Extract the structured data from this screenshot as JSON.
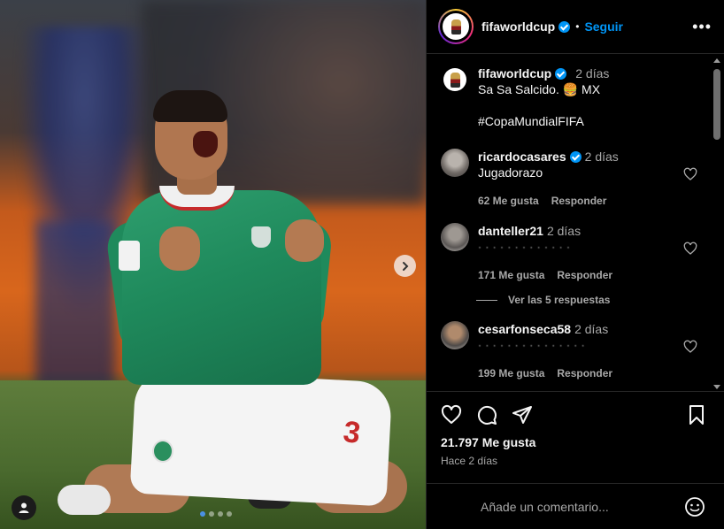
{
  "post": {
    "jersey_number": "3",
    "carousel": {
      "count": 4,
      "active": 0
    }
  },
  "header": {
    "username": "fifaworldcup",
    "separator": "•",
    "follow_label": "Seguir",
    "more_label": "•••"
  },
  "caption": {
    "username": "fifaworldcup",
    "time": "2 días",
    "text": "Sa Sa Salcido. 🍔 MX",
    "hashtag": "#CopaMundialFIFA"
  },
  "comments": [
    {
      "username": "ricardocasares",
      "verified": true,
      "time": "2 días",
      "text": "Jugadorazo",
      "likes": "62 Me gusta",
      "reply": "Responder"
    },
    {
      "username": "danteller21",
      "verified": false,
      "time": "2 días",
      "text": "",
      "likes": "171 Me gusta",
      "reply": "Responder",
      "view_replies": "Ver las 5 respuestas"
    },
    {
      "username": "cesarfonseca58",
      "verified": false,
      "time": "2 días",
      "text": "",
      "likes": "199 Me gusta",
      "reply": "Responder"
    }
  ],
  "footer": {
    "likes": "21.797 Me gusta",
    "ago": "Hace 2 días",
    "comment_placeholder": "Añade un comentario..."
  },
  "colors": {
    "accent": "#0095f6",
    "panel_bg": "#000000",
    "text": "#f5f5f5",
    "muted": "#a8a8a8"
  }
}
